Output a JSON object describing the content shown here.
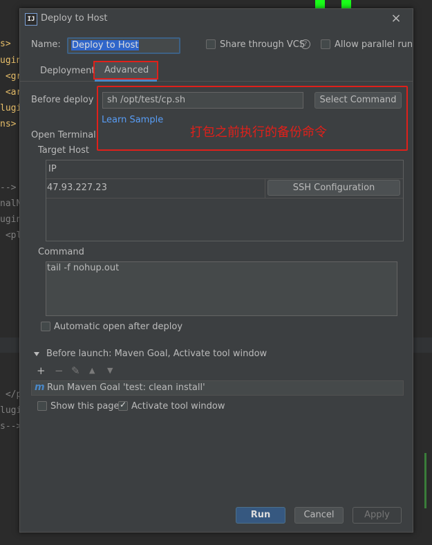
{
  "dialog": {
    "title": "Deploy to Host",
    "name_label": "Name:",
    "name_value": "Deploy to Host",
    "share_vcs_label": "Share through VCS",
    "allow_parallel_label": "Allow parallel run",
    "share_vcs_checked": false,
    "allow_parallel_checked": false
  },
  "tabs": [
    {
      "label": "Deployment",
      "active": false
    },
    {
      "label": "Advanced",
      "active": true
    }
  ],
  "advanced": {
    "before_deploy_label": "Before deploy",
    "before_deploy_value": "sh /opt/test/cp.sh",
    "select_command_label": "Select Command",
    "learn_sample_label": "Learn Sample",
    "annotation": "打包之前执行的备份命令",
    "open_terminal_label": "Open Terminal",
    "target_host_label": "Target Host",
    "table": {
      "column_ip": "IP",
      "rows": [
        {
          "ip": "47.93.227.23",
          "action": "SSH Configuration"
        }
      ]
    },
    "command_label": "Command",
    "command_value": "tail -f nohup.out",
    "auto_open_label": "Automatic open after deploy",
    "auto_open_checked": false
  },
  "before_launch": {
    "label": "Before launch: Maven Goal, Activate tool window",
    "toolbar": {
      "add": "+",
      "remove": "−",
      "edit": "✎",
      "up": "▲",
      "down": "▼"
    },
    "items": [
      {
        "icon": "maven-icon",
        "text": "Run Maven Goal 'test: clean install'"
      }
    ],
    "show_page_label": "Show this page",
    "show_page_checked": false,
    "activate_tool_label": "Activate tool window",
    "activate_tool_checked": true
  },
  "footer": {
    "run_label": "Run",
    "cancel_label": "Cancel",
    "apply_label": "Apply"
  },
  "editor_background": {
    "lines": [
      {
        "text": "s>",
        "color": "#e8bf6a"
      },
      {
        "text": "ugin",
        "color": "#e8bf6a"
      },
      {
        "text": " <gr",
        "color": "#e8bf6a"
      },
      {
        "text": " <ar",
        "color": "#e8bf6a"
      },
      {
        "text": "lugi",
        "color": "#e8bf6a"
      },
      {
        "text": "ns>",
        "color": "#e8bf6a"
      },
      {
        "text": "-->",
        "color": "#808080"
      },
      {
        "text": "nalN",
        "color": "#808080"
      },
      {
        "text": "ugin",
        "color": "#808080"
      },
      {
        "text": " <pl",
        "color": "#808080"
      },
      {
        "text": " </p",
        "color": "#808080"
      },
      {
        "text": "lugi",
        "color": "#808080"
      },
      {
        "text": "s-->",
        "color": "#808080"
      }
    ]
  },
  "colors": {
    "accent": "#4a88c7",
    "annotation_red": "#e0201a",
    "dialog_bg": "#3c3f41",
    "link": "#589df6"
  }
}
